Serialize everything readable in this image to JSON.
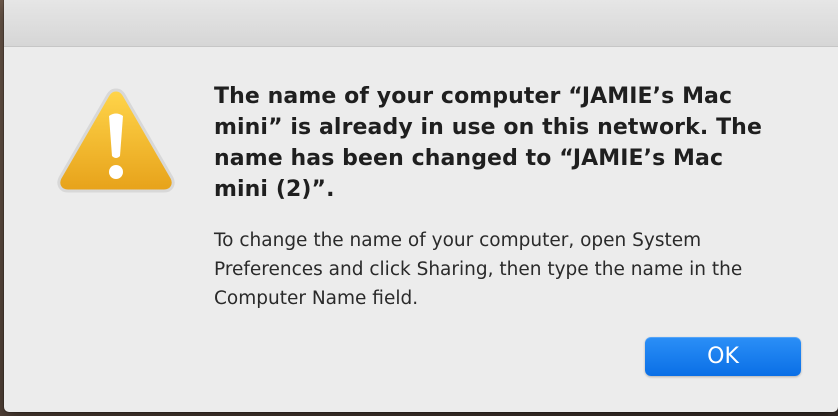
{
  "dialog": {
    "message": "The name of your computer “JAMIE’s Mac mini” is already in use on this network. The name has been changed to “JAMIE’s Mac mini (2)”.",
    "info": "To change the name of your computer, open System Preferences and click Sharing, then type the name in the Computer Name field.",
    "ok_label": "OK",
    "icon": "warning-icon"
  },
  "colors": {
    "dialog_background": "#ececec",
    "button_blue": "#1a7ff0",
    "warning_yellow": "#f0b224"
  }
}
